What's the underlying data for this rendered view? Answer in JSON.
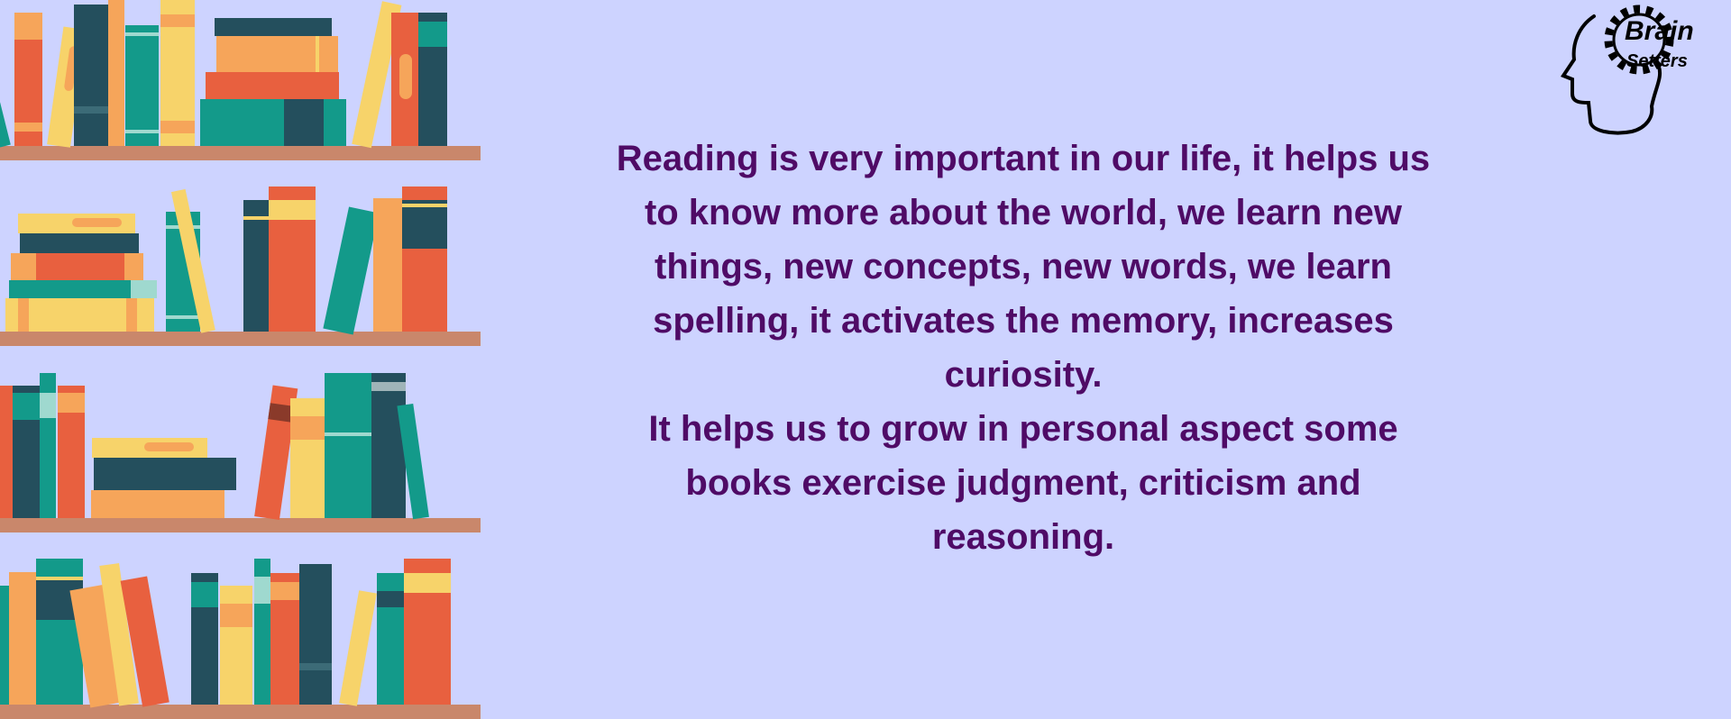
{
  "logo": {
    "line1": "Brain",
    "line2": "Setters"
  },
  "quote": {
    "paragraph1": "Reading is very important in our life, it helps us to know more about the world, we learn new things, new concepts, new words, we learn spelling, it activates the memory, increases curiosity.",
    "paragraph2": "It helps us to grow in personal aspect some books exercise judgment, criticism and reasoning."
  },
  "colors": {
    "background": "#cdd3ff",
    "text": "#4f0b66",
    "shelf": "#c9876b"
  },
  "icons": [
    "bookshelf-illustration",
    "brain-gear-head-logo"
  ]
}
